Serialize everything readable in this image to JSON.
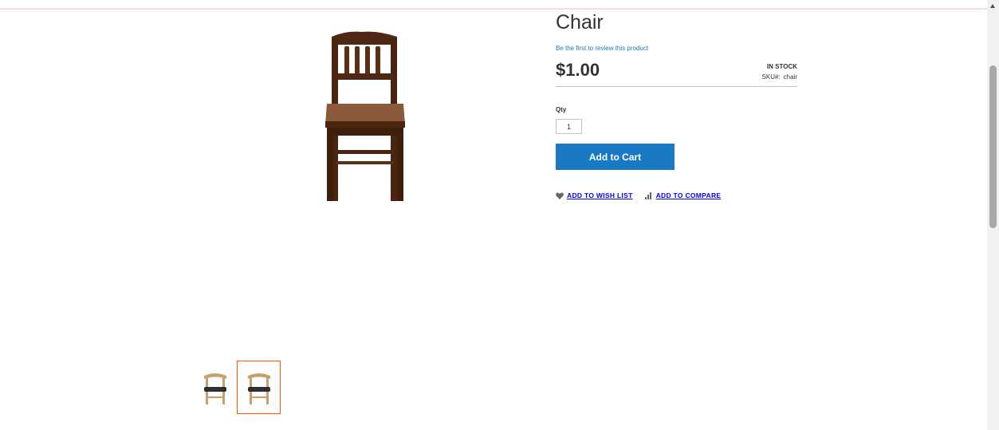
{
  "product": {
    "title": "Chair",
    "review_link": "Be the first to review this product",
    "price": "$1.00",
    "stock_status": "IN STOCK",
    "sku_label": "SKU#:",
    "sku_value": "chair"
  },
  "purchase": {
    "qty_label": "Qty",
    "qty_value": "1",
    "add_to_cart_label": "Add to Cart"
  },
  "actions": {
    "wishlist_label": "ADD TO WISH LIST",
    "compare_label": "ADD TO COMPARE"
  },
  "gallery": {
    "main_image_icon": "wooden-chair-image",
    "thumbnails": [
      "chair-thumbnail",
      "chair-thumbnail-selected"
    ]
  },
  "colors": {
    "primary_button": "#1979c3",
    "link": "#1979c3",
    "thumbnail_active_border": "#ff5501",
    "chair_wood": "#5a2f16"
  }
}
